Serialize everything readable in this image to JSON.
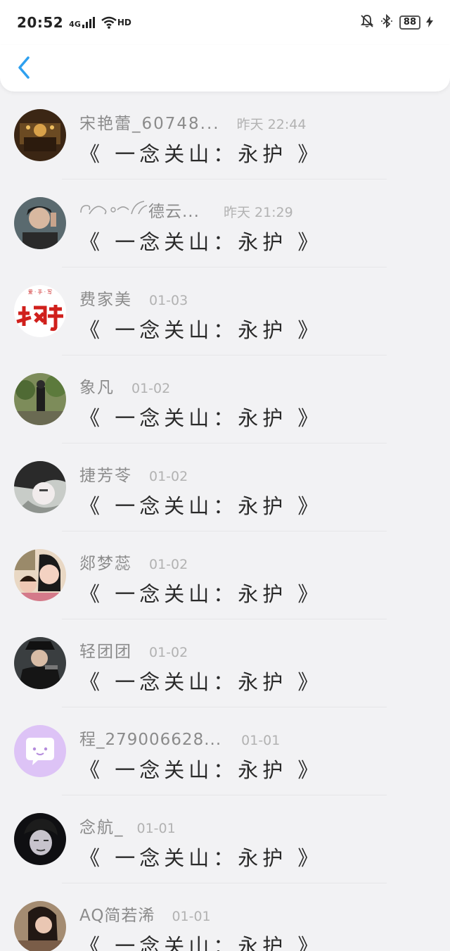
{
  "status_bar": {
    "time": "20:52",
    "network": "4G",
    "wifi_badge": "HD",
    "battery": "88"
  },
  "header": {
    "back_icon": "chevron-left-icon",
    "accent": "#2ea0ef"
  },
  "messages": [
    {
      "name": "宋艳蕾_60748...",
      "time": "昨天 22:44",
      "text": "《 一念关山：永护 》",
      "avatar": "ornate-hall"
    },
    {
      "name": "德云...",
      "name_prefix_art": "decorative-swirl-glyphs",
      "time": "昨天 21:29",
      "text": "《 一念关山：永护 》",
      "avatar": "young-man-portrait"
    },
    {
      "name": "费家美",
      "time": "01-03",
      "text": "《 一念关山：永护 》",
      "avatar": "red-calligraphy-logo"
    },
    {
      "name": "象凡",
      "time": "01-02",
      "text": "《 一念关山：永护 》",
      "avatar": "person-outdoors"
    },
    {
      "name": "捷芳苓",
      "time": "01-02",
      "text": "《 一念关山：永护 》",
      "avatar": "anime-character"
    },
    {
      "name": "郯梦蕊",
      "time": "01-02",
      "text": "《 一念关山：永护 》",
      "avatar": "two-people-selfie"
    },
    {
      "name": "轻团团",
      "time": "01-02",
      "text": "《 一念关山：永护 》",
      "avatar": "costume-drama-man"
    },
    {
      "name": "程_279006628...",
      "time": "01-01",
      "text": "《 一念关山：永护 》",
      "avatar": "default-chat-bubble"
    },
    {
      "name": "念航_",
      "time": "01-01",
      "text": "《 一念关山：永护 》",
      "avatar": "dark-portrait"
    },
    {
      "name": "AQ简若浠",
      "time": "01-01",
      "text": "《 一念关山：永护 》",
      "avatar": "woman-portrait"
    }
  ]
}
